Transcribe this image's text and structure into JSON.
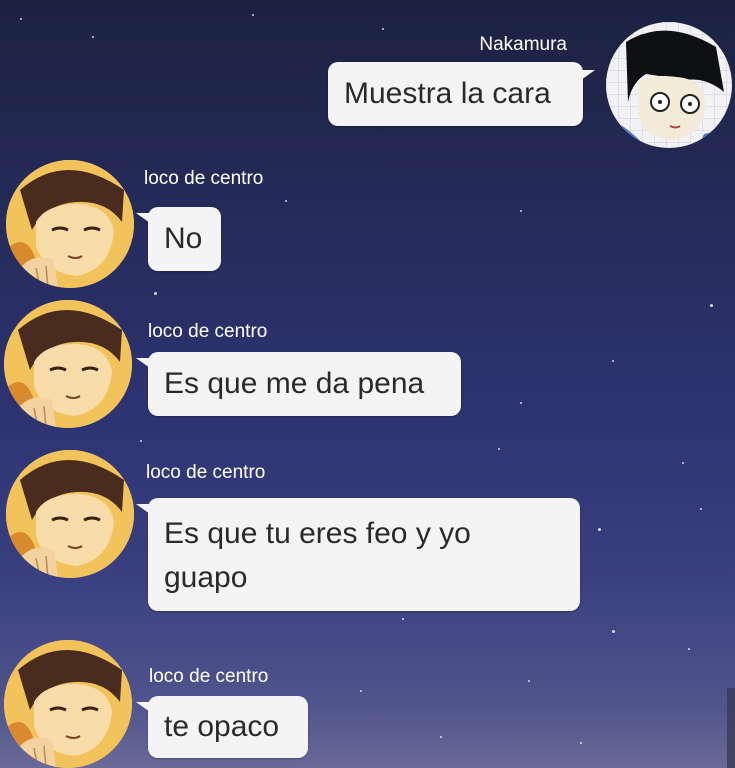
{
  "chat": {
    "messages": [
      {
        "sender": "Nakamura",
        "text": "Muestra la cara"
      },
      {
        "sender": "loco de centro",
        "text": "No"
      },
      {
        "sender": "loco de centro",
        "text": "Es que me da pena"
      },
      {
        "sender": "loco de centro",
        "text": "Es que tu eres feo y yo guapo",
        "lines": [
          "Es que tu eres feo y yo",
          "guapo"
        ]
      },
      {
        "sender": "loco de centro",
        "text": "te opaco"
      }
    ]
  },
  "colors": {
    "bubble": "#f4f4f5",
    "bubble_text": "#2a2a2a",
    "name_text": "#ffffff",
    "background_top": "#1b2240",
    "background_bottom": "#6a6a98"
  },
  "icons": {
    "nakamura_avatar": "anime-boy-dark-hair-avatar",
    "loco_avatar": "anime-boy-brown-hair-avatar"
  }
}
